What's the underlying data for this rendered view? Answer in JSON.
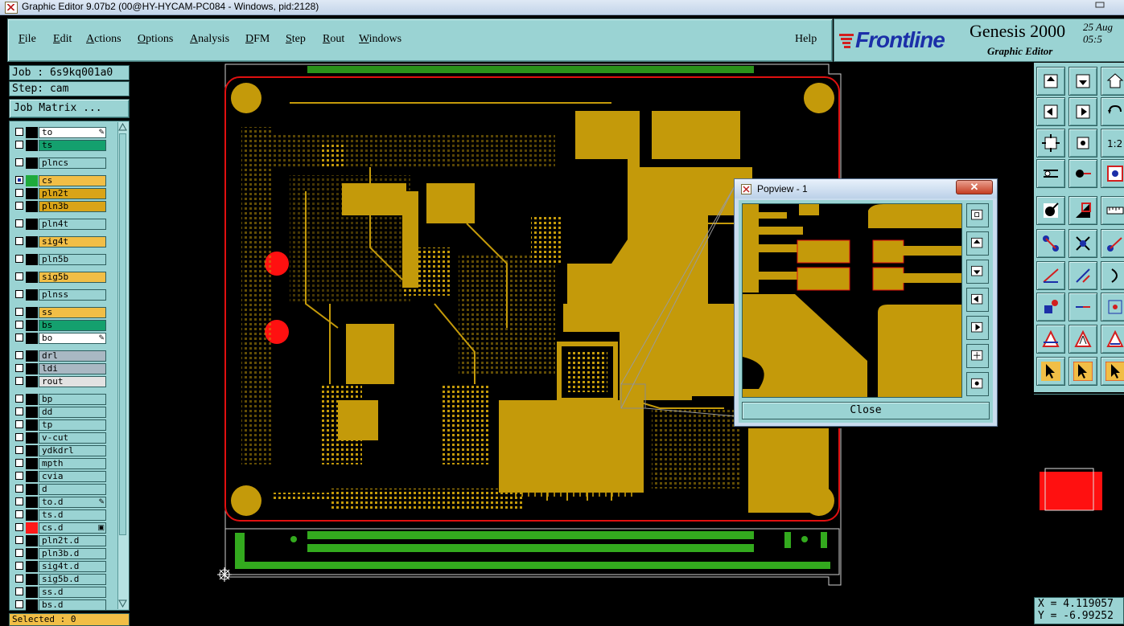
{
  "window": {
    "title": "Graphic Editor 9.07b2 (00@HY-HYCAM-PC084 - Windows, pid:2128)"
  },
  "menu": {
    "items": [
      {
        "label": "File",
        "key": "F",
        "rest": "ile"
      },
      {
        "label": "Edit",
        "key": "E",
        "rest": "dit"
      },
      {
        "label": "Actions",
        "key": "A",
        "rest": "ctions"
      },
      {
        "label": "Options",
        "key": "O",
        "rest": "ptions"
      },
      {
        "label": "Analysis",
        "key": "A",
        "rest": "nalysis"
      },
      {
        "label": "DFM",
        "key": "D",
        "rest": "FM"
      },
      {
        "label": "Step",
        "key": "S",
        "rest": "tep"
      },
      {
        "label": "Rout",
        "key": "R",
        "rest": "out"
      },
      {
        "label": "Windows",
        "key": "W",
        "rest": "indows"
      }
    ],
    "help": "Help"
  },
  "brand": {
    "logo": "Frontline",
    "product": "Genesis 2000",
    "subtitle": "Graphic Editor",
    "date_line1": "25 Aug",
    "date_line2": "05:5"
  },
  "job": {
    "job_label": "Job : 6s9kq001a0",
    "step_label": "Step: cam",
    "matrix_button": "Job Matrix ..."
  },
  "layers": [
    {
      "name": "to",
      "color": "#ffffff",
      "mark": "edit"
    },
    {
      "name": "ts",
      "color": "#14a06e"
    },
    {
      "name": "plncs",
      "color": "#9ad3d3"
    },
    {
      "name": "cs",
      "color": "#f1be46",
      "active": true
    },
    {
      "name": "pln2t",
      "color": "#d9a418"
    },
    {
      "name": "pln3b",
      "color": "#d9a418"
    },
    {
      "name": "pln4t",
      "color": "#9ad3d3"
    },
    {
      "name": "sig4t",
      "color": "#f1be46"
    },
    {
      "name": "pln5b",
      "color": "#9ad3d3"
    },
    {
      "name": "sig5b",
      "color": "#f1be46"
    },
    {
      "name": "plnss",
      "color": "#9ad3d3"
    },
    {
      "name": "ss",
      "color": "#f1be46"
    },
    {
      "name": "bs",
      "color": "#14a06e"
    },
    {
      "name": "bo",
      "color": "#ffffff",
      "mark": "edit"
    },
    {
      "name": "drl",
      "color": "#a9b8c3"
    },
    {
      "name": "ldi",
      "color": "#a9b8c3"
    },
    {
      "name": "rout",
      "color": "#e2e2e2"
    },
    {
      "name": "bp",
      "color": "#9ad3d3"
    },
    {
      "name": "dd",
      "color": "#9ad3d3"
    },
    {
      "name": "tp",
      "color": "#9ad3d3"
    },
    {
      "name": "v-cut",
      "color": "#9ad3d3"
    },
    {
      "name": "ydkdrl",
      "color": "#9ad3d3"
    },
    {
      "name": "mpth",
      "color": "#9ad3d3"
    },
    {
      "name": "cvia",
      "color": "#9ad3d3"
    },
    {
      "name": "d",
      "color": "#9ad3d3"
    },
    {
      "name": "to.d",
      "color": "#9ad3d3",
      "mark": "edit"
    },
    {
      "name": "ts.d",
      "color": "#9ad3d3"
    },
    {
      "name": "cs.d",
      "color": "#9ad3d3",
      "swatch": "#ff1a1a",
      "mark": "box"
    },
    {
      "name": "pln2t.d",
      "color": "#9ad3d3"
    },
    {
      "name": "pln3b.d",
      "color": "#9ad3d3"
    },
    {
      "name": "sig4t.d",
      "color": "#9ad3d3"
    },
    {
      "name": "sig5b.d",
      "color": "#9ad3d3"
    },
    {
      "name": "ss.d",
      "color": "#9ad3d3"
    },
    {
      "name": "bs.d",
      "color": "#9ad3d3"
    }
  ],
  "status": {
    "selected": "Selected : 0"
  },
  "popview": {
    "title": "Popview - 1",
    "close_label": "Close",
    "close_x": "✕"
  },
  "coords": {
    "x": "X = 4.119057",
    "y": "Y = -6.99252"
  },
  "colors": {
    "copper": "#c49a0a",
    "outline": "#e01010",
    "pad_green": "#33aa1e",
    "panel": "#9ad3d3"
  }
}
